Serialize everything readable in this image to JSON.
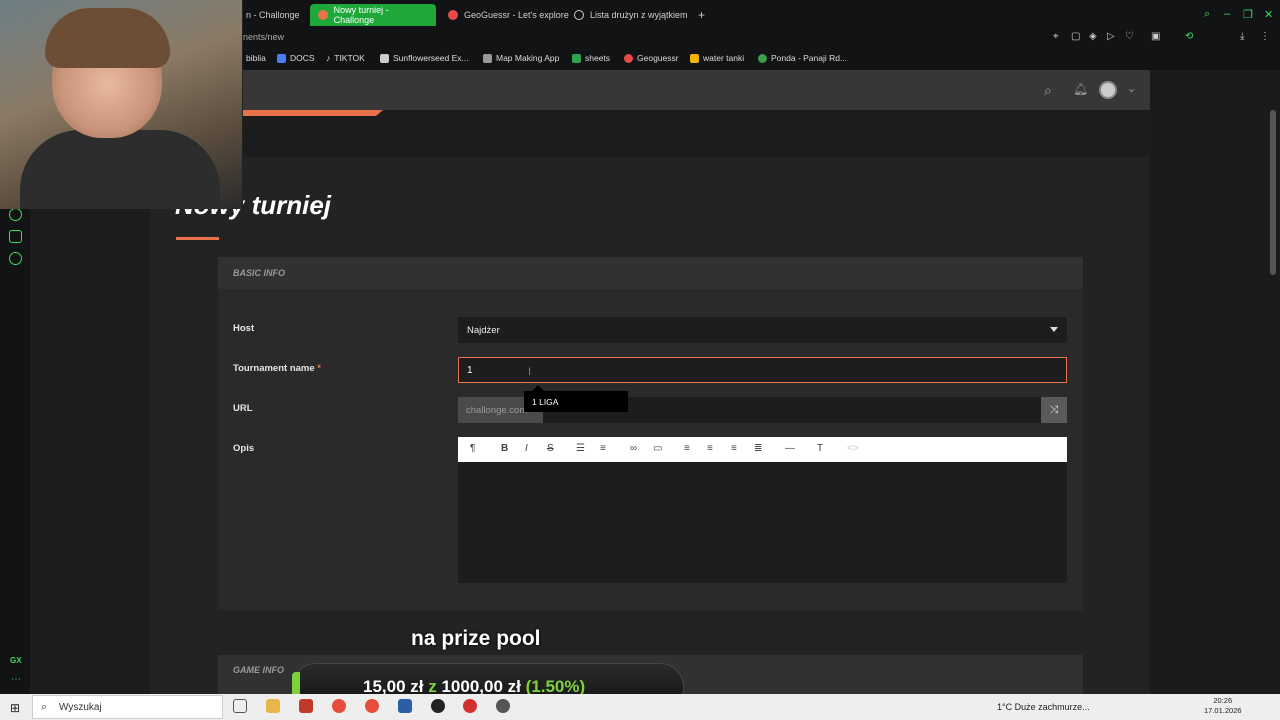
{
  "browser": {
    "tabs": [
      {
        "label": "n - Challonge",
        "active": false
      },
      {
        "label": "Nowy turniej - Challonge",
        "active": true
      },
      {
        "label": "GeoGuessr - Let's explore",
        "active": false
      },
      {
        "label": "Lista drużyn z wyjątkiem",
        "active": false
      }
    ],
    "new_tab_label": "+",
    "url": "nents/new",
    "bookmarks": [
      "biblia",
      "DOCS",
      "TIKTOK",
      "Sunflowerseed Ex...",
      "Map Making App",
      "sheets",
      "Geoguessr",
      "water tanki",
      "Ponda - Panaji Rd..."
    ]
  },
  "page": {
    "title": "Nowy turniej",
    "basic_info_heading": "BASIC INFO",
    "game_info_heading": "GAME INFO",
    "host_label": "Host",
    "host_value": "Najdżer",
    "tournament_name_label": "Tournament name",
    "required_mark": "*",
    "tournament_name_value": "1",
    "url_label": "URL",
    "url_prefix": "challonge.com",
    "autocomplete_suggestion": "1 LIGA",
    "description_label": "Opis",
    "editor_tools": [
      "paragraph-icon",
      "bold-icon",
      "italic-icon",
      "strikethrough-icon",
      "bullet-list-icon",
      "numbered-list-icon",
      "link-icon",
      "image-icon",
      "align-left-icon",
      "align-center-icon",
      "align-right-icon",
      "justify-icon",
      "horizontal-rule-icon",
      "clear-format-icon",
      "code-icon"
    ]
  },
  "overlay": {
    "caption": "na prize pool",
    "pool_current": "15,00 zł",
    "pool_of": "z",
    "pool_total": "1000,00 zł",
    "pool_percent": "(1.50%)",
    "pool_progress_fraction": 0.015
  },
  "taskbar": {
    "search_placeholder": "Wyszukaj",
    "weather": "1°C  Duże zachmurze...",
    "time": "20:26",
    "date": "17.01.2026"
  },
  "colors": {
    "accent_orange": "#e8734a",
    "browser_green": "#1fa83a",
    "progress_green": "#7fd33a"
  }
}
